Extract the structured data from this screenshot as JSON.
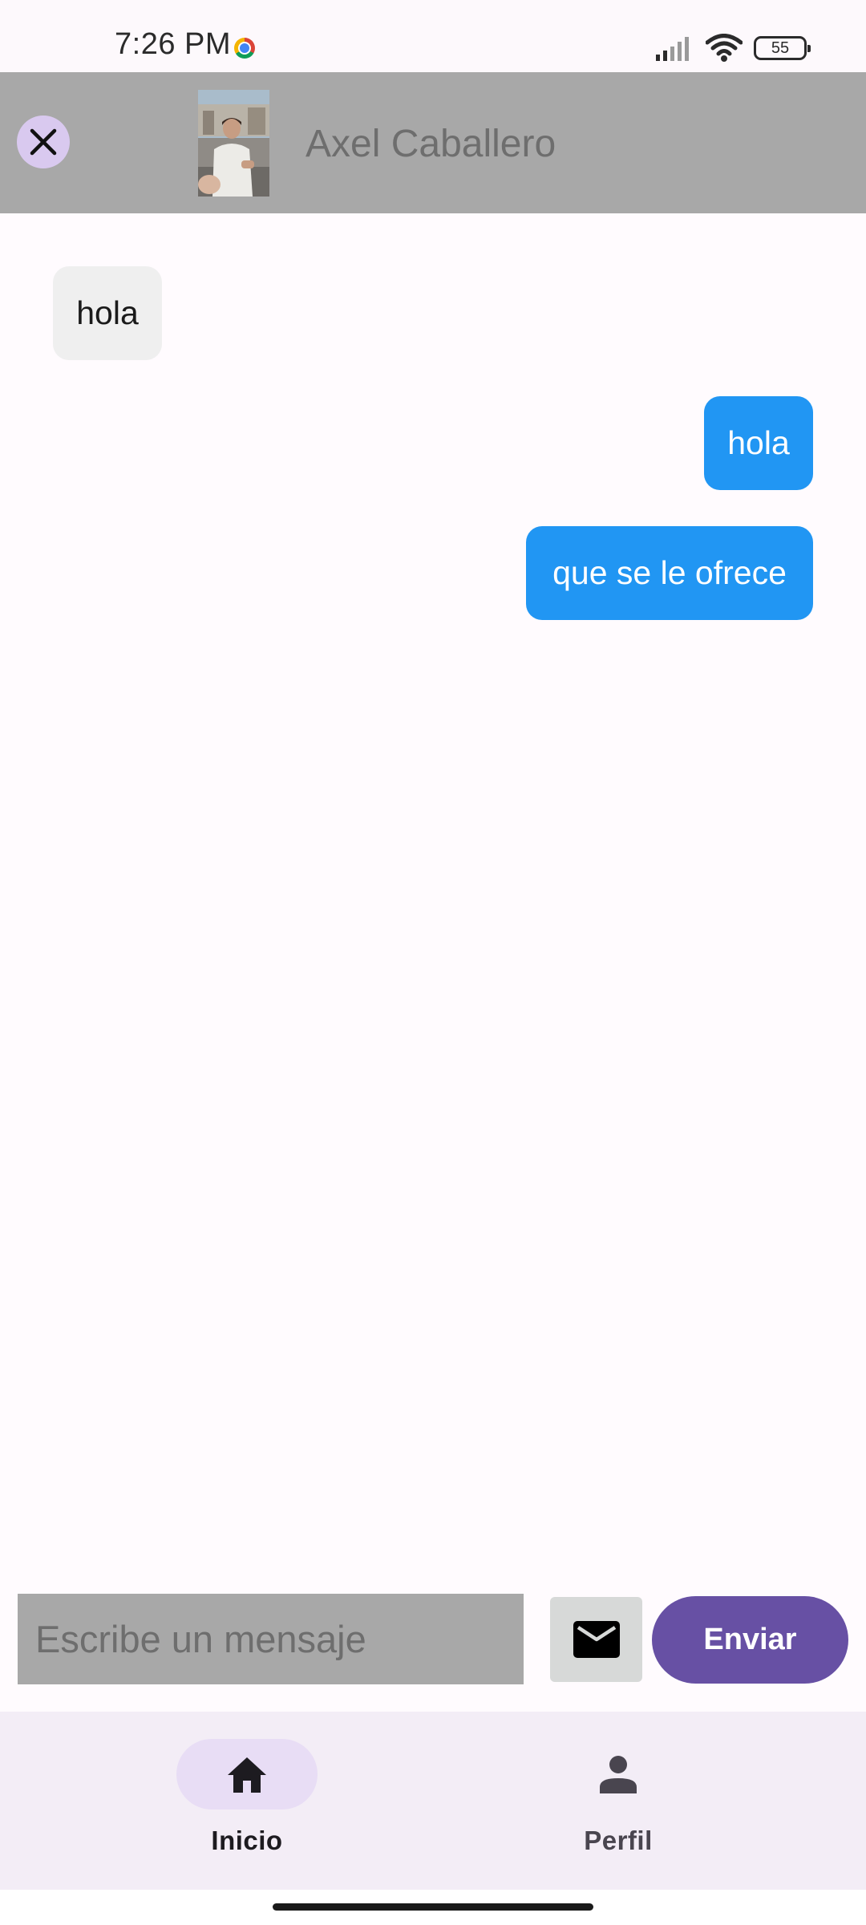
{
  "status_bar": {
    "time": "7:26 PM",
    "battery": "55",
    "icons": [
      "chrome-icon",
      "signal-icon",
      "wifi-icon",
      "battery-icon"
    ]
  },
  "header": {
    "contact_name": "Axel Caballero",
    "close_icon": "close-icon"
  },
  "messages": [
    {
      "sender": "contact",
      "text": "hola"
    },
    {
      "sender": "me",
      "text": "hola"
    },
    {
      "sender": "me",
      "text": "que se le ofrece"
    }
  ],
  "composer": {
    "placeholder": "Escribe un mensaje",
    "value": "",
    "attach_icon": "mail-icon",
    "send_label": "Enviar"
  },
  "bottom_nav": {
    "items": [
      {
        "label": "Inicio",
        "icon": "home-icon",
        "active": true
      },
      {
        "label": "Perfil",
        "icon": "person-icon",
        "active": false
      }
    ]
  },
  "colors": {
    "header_bg": "#a8a8a8",
    "incoming_bubble": "#efefef",
    "outgoing_bubble": "#2196f3",
    "send_button": "#6750a4",
    "nav_bg": "#f3edf6",
    "nav_active_pill": "#e8ddf5"
  }
}
